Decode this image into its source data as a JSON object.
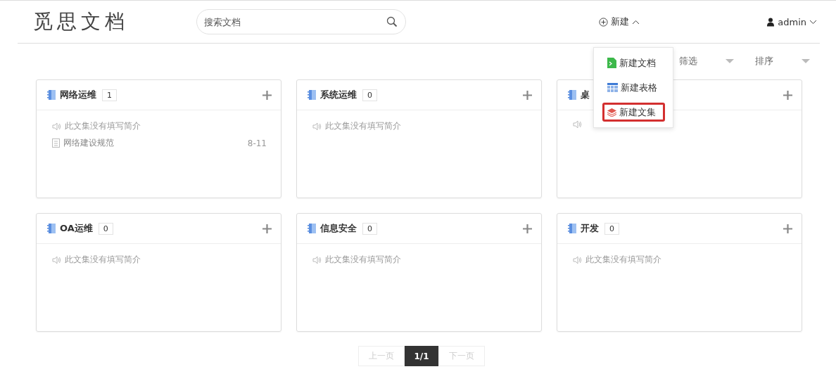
{
  "header": {
    "logo": "觅思文档",
    "search": {
      "placeholder": "搜索文档"
    },
    "new_button": {
      "label": "新建",
      "expanded": true
    },
    "user": {
      "name": "admin"
    }
  },
  "new_menu": [
    {
      "kind": "doc",
      "label": "新建文档",
      "selected": false
    },
    {
      "kind": "sheet",
      "label": "新建表格",
      "selected": false
    },
    {
      "kind": "collection",
      "label": "新建文集",
      "selected": true
    }
  ],
  "toolbar": {
    "filter": "筛选",
    "sort": "排序"
  },
  "collections": [
    {
      "title": "网络运维",
      "count": "1",
      "intro": "此文集没有填写简介",
      "docs": [
        {
          "title": "网络建设规范",
          "date": "8-11"
        }
      ]
    },
    {
      "title": "系统运维",
      "count": "0",
      "intro": "此文集没有填写简介"
    },
    {
      "title": "桌"
    },
    {
      "title": "OA运维",
      "count": "0",
      "intro": "此文集没有填写简介"
    },
    {
      "title": "信息安全",
      "count": "0",
      "intro": "此文集没有填写简介"
    },
    {
      "title": "开发",
      "count": "0",
      "intro": "此文集没有填写简介"
    }
  ],
  "pagination": {
    "prev": "上一页",
    "current": "1/1",
    "next": "下一页"
  }
}
